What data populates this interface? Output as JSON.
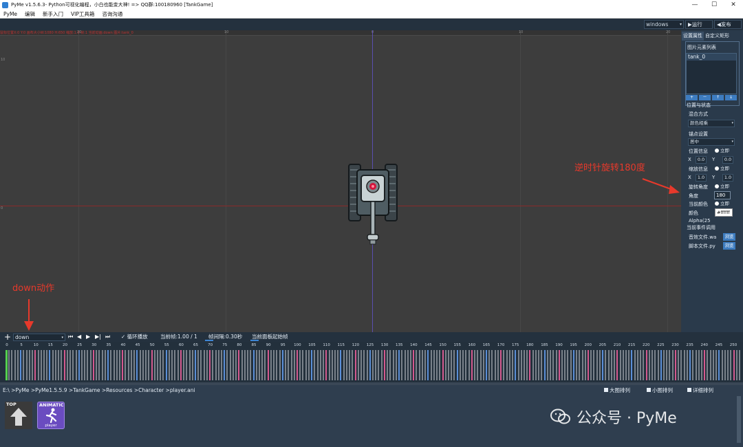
{
  "window": {
    "title": "PyMe v1.5.6.3- Python可视化编程，小白也能变大神!   => QQ群:100180960    [TankGame]",
    "controls": [
      "—",
      "☐",
      "✕"
    ]
  },
  "menu": [
    "PyMe",
    "编辑",
    "新手入门",
    "VIP工具箱",
    "咨询沟通"
  ],
  "toolbar": {
    "platform": "windows",
    "run_label": "▶运行",
    "publish_label": "◀发布"
  },
  "canvas": {
    "status_text": "鼠标位置X:0 Y:0 画布大小W:1080 H:650 缩放:1.0 帧:1 当前动画:down 图片:tank_0",
    "ruler_labels": [
      "20",
      "10",
      "0",
      "10",
      "20"
    ],
    "ruler_left_labels": [
      "10",
      "0"
    ]
  },
  "annotations": {
    "rotate_note": "逆时针旋转180度",
    "action_note": "down动作"
  },
  "panel": {
    "tabs": [
      "设置属性",
      "自定义矩形"
    ],
    "image_list_title": "图片元素列表",
    "image_items": [
      "tank_0"
    ],
    "list_buttons": [
      "+",
      "－",
      "↑",
      "↓"
    ],
    "position_state_title": "位置与状态",
    "blend_label": "混合方式",
    "blend_value": "颜色相乘",
    "anchor_label": "锚点设置",
    "anchor_value": "居中",
    "position_label": "位置信息",
    "position_toggle": "立即",
    "pos_x_label": "X",
    "pos_x": "0.0",
    "pos_y_label": "Y",
    "pos_y": "0.0",
    "scale_label": "缩放信息",
    "scale_toggle": "立即",
    "scale_x_label": "X",
    "scale_x": "1.0",
    "scale_y_label": "Y",
    "scale_y": "1.0",
    "rotate_label": "旋转角度",
    "rotate_toggle": "立即",
    "angle_label": "角度",
    "angle_value": "180",
    "color_title": "当前颜色",
    "color_toggle": "立即",
    "color_label": "颜色",
    "color_value": "#ffffff",
    "alpha_label": "Alpha(25",
    "event_title": "当前事件调用",
    "sound_label": "音效文件.wa",
    "script_label": "脚本文件.py",
    "browse_label": "浏览"
  },
  "timeline": {
    "action": "down",
    "controls": [
      "⏮",
      "◀",
      "▶",
      "▶|",
      "⏭"
    ],
    "loop_label": "✓ 循环播放",
    "current_frame": "当前帧:1.00 / 1",
    "frame_interval": "帧间隔:0.30秒",
    "panel_start": "当前面板起始帧",
    "frame_numbers": [
      0,
      5,
      10,
      15,
      20,
      25,
      30,
      35,
      40,
      45,
      50,
      55,
      60,
      65,
      70,
      75,
      80,
      85,
      90,
      95,
      100,
      105,
      110,
      115,
      120,
      125,
      130,
      135,
      140,
      145,
      150,
      155,
      160,
      165,
      170,
      175,
      180,
      185,
      190,
      195,
      200,
      205,
      210,
      215,
      220,
      225,
      230,
      235,
      240,
      245,
      250
    ]
  },
  "explorer": {
    "path": "E:\\ >PyMe >PyMe1.5.5.9 >TankGame >Resources >Character >player.ani",
    "views": [
      "大图排列",
      "小图排列",
      "详细排列"
    ],
    "top_tile": "TOP",
    "anim_tile": "ANIMATIC",
    "anim_file": "player"
  },
  "watermark": "公众号 · PyMe",
  "colors": {
    "frame_pink": "#d55a8f",
    "frame_blue": "#5b8fd8",
    "frame_gray": "#7a828b",
    "frame_current": "#55d14f",
    "annotation_red": "#e8392b"
  }
}
